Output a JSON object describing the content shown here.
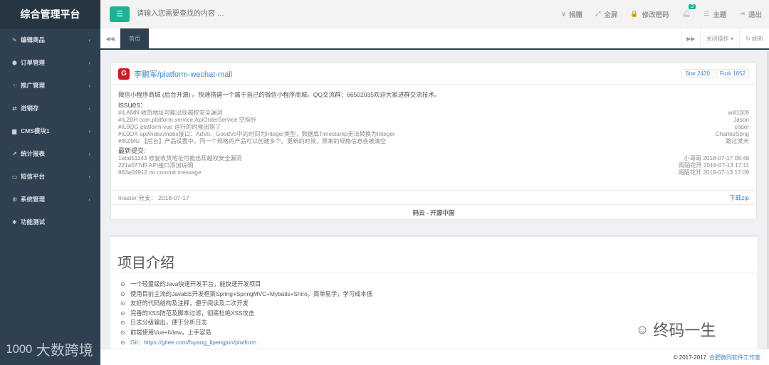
{
  "brand": {
    "title": "综合管理平台"
  },
  "sidebar": {
    "items": [
      {
        "icon": "✎",
        "label": "编辑商品"
      },
      {
        "icon": "⬢",
        "label": "订单管理"
      },
      {
        "icon": "☜",
        "label": "推广管理"
      },
      {
        "icon": "⇄",
        "label": "进销存"
      },
      {
        "icon": "▆",
        "label": "CMS模块1"
      },
      {
        "icon": "↗",
        "label": "统计报表"
      },
      {
        "icon": "▭",
        "label": "短信平台"
      },
      {
        "icon": "⚙",
        "label": "系统管理"
      },
      {
        "icon": "✱",
        "label": "功能测试"
      }
    ],
    "watermark": "大数跨境",
    "watermark_logo": "1000"
  },
  "header": {
    "search_placeholder": "请输入您需要查找的内容 …",
    "nav": [
      {
        "icon": "¥",
        "label": "捐赠"
      },
      {
        "icon": "⤢",
        "label": "全屏"
      },
      {
        "icon": "🔒",
        "label": "修改密码"
      }
    ],
    "bell_badge": "2",
    "nav_after": [
      {
        "icon": "☰",
        "label": "主题"
      },
      {
        "icon": "⇥",
        "label": "退出"
      }
    ]
  },
  "tabs": {
    "home": "首页",
    "close_ops": "关闭操作",
    "refresh": "刷新"
  },
  "repo": {
    "name": "李鹏军/platform-wechat-mall",
    "star": "Star 2430",
    "fork": "Fork 1052",
    "description": "微信小程序商城 (后台开源) 。快速搭建一个属于自己的微信小程序商城。QQ交流群：66502035欢迎大家进群交流技术。",
    "issues_title": "issues:",
    "issues": [
      {
        "text": "#ILAMN 收货地址可能出现越权安全漏洞",
        "author": "will1009"
      },
      {
        "text": "#IL2BH com.platform.service.ApiOrderService 空指针",
        "author": "Jason"
      },
      {
        "text": "#IL0QG platform-vue 运行的时候出错了",
        "author": "coder"
      },
      {
        "text": "#IL0OX api/index/index接口：AdVo、GoodVo中的时间为Integer类型，数据库Timestamp无法转换为Integer",
        "author": "CharlesSong"
      },
      {
        "text": "#IKZMU 【后台】产品设置中，同一个规格的产品可以创建多个。更新的时候，原来的规格信息会被清空",
        "author": "路过某天"
      }
    ],
    "commits_title": "最新提交:",
    "commits": [
      {
        "text": "1ebd51143   修复收货地址可能出现越权安全漏洞",
        "author": "小哥哥 2018-07-17 09:48"
      },
      {
        "text": "221a077d5   API接口添加说明",
        "author": "雨陌花开 2018-07-13 17:11"
      },
      {
        "text": "863a04912   no commit message",
        "author": "雨陌花开 2018-07-13 17:09"
      }
    ],
    "branch": "master 分支： 2018-07-17",
    "download": "下载zip",
    "source": "码云 - 开源中国"
  },
  "intro": {
    "title": "项目介绍",
    "items": [
      "一个轻量级的Java快速开发平台，能快速开发项目",
      "使用目前主流的JavaEE开发框架Spring+SpringMVC+Mybatis+Shiro，简单易学，学习成本低",
      "友好的代码结构及注释，便于阅读及二次开发",
      "完善的XSS防范及脚本过滤，彻底杜绝XSS攻击",
      "日志分级输出，便于分析日志",
      "前端使用Vue+iView，上手容易"
    ],
    "link": "Git：https://gitee.com/fuyang_lipengjun/platform",
    "watermark": "终码一生"
  },
  "footer": {
    "copyright": "© 2017-2017",
    "org": "合肥微同软件工作室"
  }
}
